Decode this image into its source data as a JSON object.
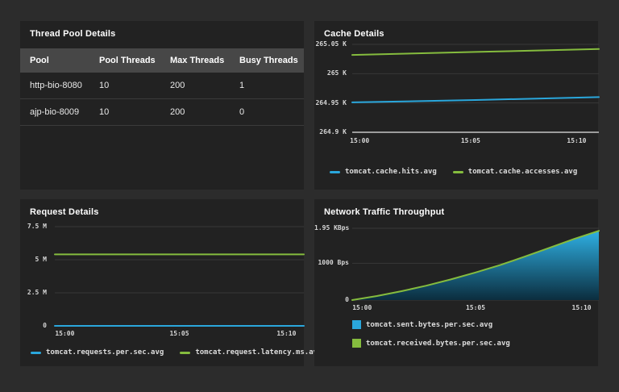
{
  "colors": {
    "blue": "#2aa7dc",
    "green": "#85bc3e",
    "grid": "#383838",
    "axis": "#9c9c9c",
    "area_top": "#2fb0e3",
    "area_bottom": "#0b2d3e",
    "page_bg": "#2c2c2c",
    "panel_bg": "#222222",
    "table_header_bg": "#474747"
  },
  "panels": {
    "thread_pool": {
      "title": "Thread Pool Details",
      "table": {
        "columns": [
          "Pool",
          "Pool Threads",
          "Max Threads",
          "Busy Threads"
        ],
        "rows": [
          [
            "http-bio-8080",
            "10",
            "200",
            "1"
          ],
          [
            "ajp-bio-8009",
            "10",
            "200",
            "0"
          ]
        ]
      }
    }
  },
  "chart_data": [
    {
      "id": "cache",
      "title": "Cache Details",
      "type": "line",
      "x_ticks": [
        "15:00",
        "15:05",
        "15:10"
      ],
      "y_range": [
        264.9,
        265.05
      ],
      "y_ticks": [
        {
          "value": 265.05,
          "label": "265.05 K"
        },
        {
          "value": 265.0,
          "label": "265 K"
        },
        {
          "value": 264.95,
          "label": "264.95 K"
        },
        {
          "value": 264.9,
          "label": "264.9 K"
        }
      ],
      "unit": "K",
      "grid": true,
      "legend_position": "bottom",
      "series": [
        {
          "name": "tomcat.cache.hits.avg",
          "color_key": "blue",
          "values": [
            264.951,
            264.953,
            264.955,
            264.9575,
            264.96
          ]
        },
        {
          "name": "tomcat.cache.accesses.avg",
          "color_key": "green",
          "values": [
            265.032,
            265.0345,
            265.037,
            265.0395,
            265.042
          ]
        }
      ]
    },
    {
      "id": "request",
      "title": "Request Details",
      "type": "line",
      "x_ticks": [
        "15:00",
        "15:05",
        "15:10"
      ],
      "y_range": [
        0,
        7.5
      ],
      "y_ticks": [
        {
          "value": 7.5,
          "label": "7.5 M"
        },
        {
          "value": 5,
          "label": "5 M"
        },
        {
          "value": 2.5,
          "label": "2.5 M"
        },
        {
          "value": 0,
          "label": "0"
        }
      ],
      "unit": "M",
      "grid": true,
      "legend_position": "bottom",
      "series": [
        {
          "name": "tomcat.requests.per.sec.avg",
          "color_key": "blue",
          "values": [
            0,
            0,
            0,
            0,
            0
          ]
        },
        {
          "name": "tomcat.request.latency.ms.avg",
          "color_key": "green",
          "values": [
            5.4,
            5.4,
            5.4,
            5.4,
            5.4
          ]
        }
      ]
    },
    {
      "id": "network",
      "title": "Network Traffic Throughput",
      "type": "area",
      "x_ticks": [
        "15:00",
        "15:05",
        "15:10"
      ],
      "y_range": [
        0,
        1950
      ],
      "y_ticks": [
        {
          "value": 1950,
          "label": "1.95 KBps"
        },
        {
          "value": 1000,
          "label": "1000 Bps"
        },
        {
          "value": 0,
          "label": "0"
        }
      ],
      "unit": "Bps",
      "grid": true,
      "legend_position": "bottom",
      "series": [
        {
          "name": "tomcat.sent.bytes.per.sec.avg",
          "color_key": "blue",
          "render": "area",
          "values": [
            0,
            110,
            240,
            390,
            560,
            750,
            950,
            1180,
            1420,
            1660,
            1880
          ]
        },
        {
          "name": "tomcat.received.bytes.per.sec.avg",
          "color_key": "green",
          "render": "line",
          "values": [
            0,
            110,
            240,
            390,
            560,
            750,
            950,
            1180,
            1420,
            1660,
            1880
          ]
        }
      ]
    }
  ]
}
